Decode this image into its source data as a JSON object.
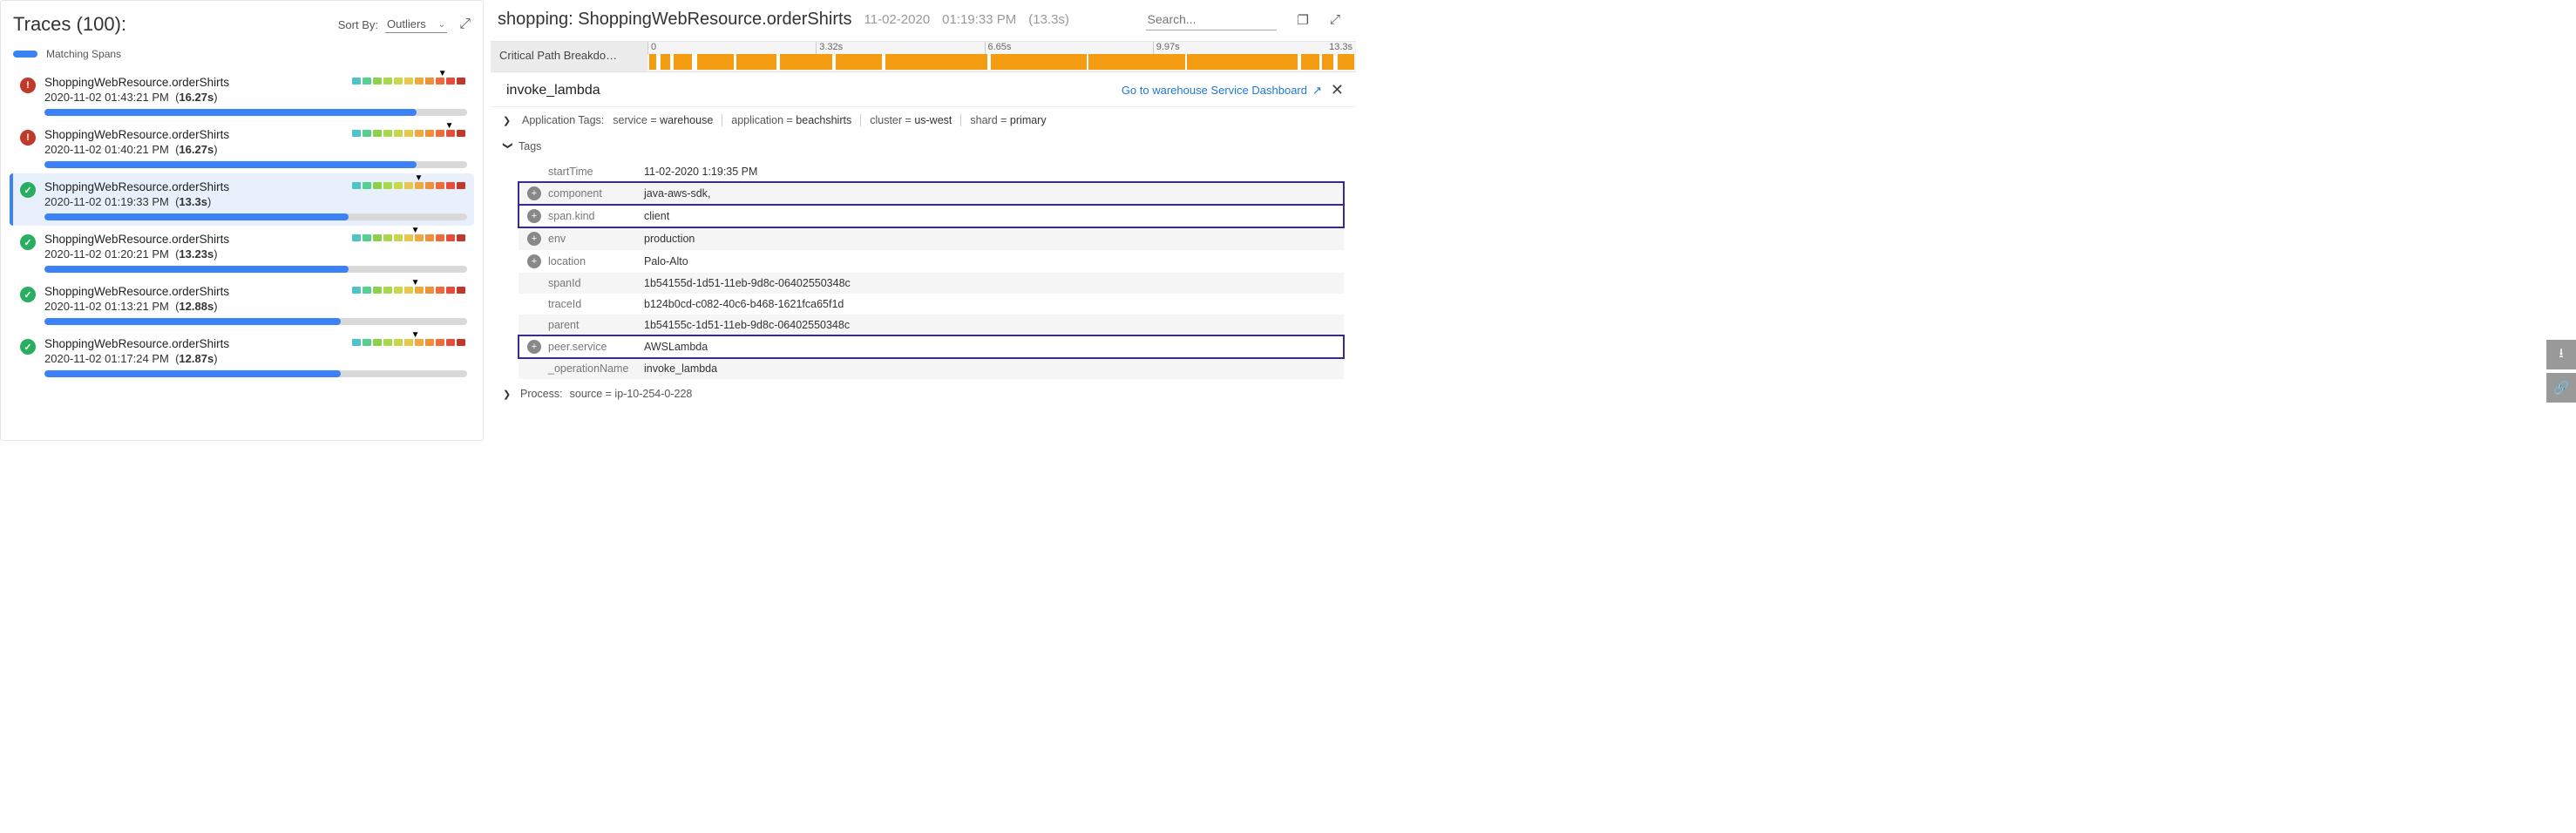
{
  "left": {
    "title": "Traces (100):",
    "sortLabel": "Sort By:",
    "sortValue": "Outliers",
    "legend": "Matching Spans",
    "traces": [
      {
        "status": "error",
        "name": "ShoppingWebResource.orderShirts",
        "ts": "2020-11-02 01:43:21 PM",
        "dur": "16.27s",
        "prog": 88,
        "marker": 76,
        "selected": false
      },
      {
        "status": "error",
        "name": "ShoppingWebResource.orderShirts",
        "ts": "2020-11-02 01:40:21 PM",
        "dur": "16.27s",
        "prog": 88,
        "marker": 82,
        "selected": false
      },
      {
        "status": "ok",
        "name": "ShoppingWebResource.orderShirts",
        "ts": "2020-11-02 01:19:33 PM",
        "dur": "13.3s",
        "prog": 72,
        "marker": 55,
        "selected": true
      },
      {
        "status": "ok",
        "name": "ShoppingWebResource.orderShirts",
        "ts": "2020-11-02 01:20:21 PM",
        "dur": "13.23s",
        "prog": 72,
        "marker": 52,
        "selected": false
      },
      {
        "status": "ok",
        "name": "ShoppingWebResource.orderShirts",
        "ts": "2020-11-02 01:13:21 PM",
        "dur": "12.88s",
        "prog": 70,
        "marker": 52,
        "selected": false
      },
      {
        "status": "ok",
        "name": "ShoppingWebResource.orderShirts",
        "ts": "2020-11-02 01:17:24 PM",
        "dur": "12.87s",
        "prog": 70,
        "marker": 52,
        "selected": false
      }
    ]
  },
  "right": {
    "titlePrefix": "shopping: ",
    "titleMain": "ShoppingWebResource.orderShirts",
    "date": "11-02-2020",
    "time": "01:19:33 PM",
    "dur": "(13.3s)",
    "searchPlaceholder": "Search...",
    "timelineLabel": "Critical Path Breakdo…",
    "ticks": [
      "0",
      "3.32s",
      "6.65s",
      "9.97s",
      "13.3s"
    ],
    "spanName": "invoke_lambda",
    "dashLink": "Go to warehouse Service Dashboard",
    "appTagsLabel": "Application Tags:",
    "appTags": [
      {
        "k": "service",
        "v": "warehouse"
      },
      {
        "k": "application",
        "v": "beachshirts"
      },
      {
        "k": "cluster",
        "v": "us-west"
      },
      {
        "k": "shard",
        "v": "primary"
      }
    ],
    "tagsLabel": "Tags",
    "tags": [
      {
        "add": false,
        "key": "startTime",
        "val": "11-02-2020 1:19:35 PM",
        "alt": false,
        "boxed": false
      },
      {
        "add": true,
        "key": "component",
        "val": "java-aws-sdk,",
        "alt": true,
        "boxed": true
      },
      {
        "add": true,
        "key": "span.kind",
        "val": "client",
        "alt": false,
        "boxed": true
      },
      {
        "add": true,
        "key": "env",
        "val": "production",
        "alt": true,
        "boxed": false
      },
      {
        "add": true,
        "key": "location",
        "val": "Palo-Alto",
        "alt": false,
        "boxed": false
      },
      {
        "add": false,
        "key": "spanId",
        "val": "1b54155d-1d51-11eb-9d8c-06402550348c",
        "alt": true,
        "boxed": false
      },
      {
        "add": false,
        "key": "traceId",
        "val": "b124b0cd-c082-40c6-b468-1621fca65f1d",
        "alt": false,
        "boxed": false
      },
      {
        "add": false,
        "key": "parent",
        "val": "1b54155c-1d51-11eb-9d8c-06402550348c",
        "alt": true,
        "boxed": false
      },
      {
        "add": true,
        "key": "peer.service",
        "val": "AWSLambda",
        "alt": false,
        "boxed": true
      },
      {
        "add": false,
        "key": "_operationName",
        "val": "invoke_lambda",
        "alt": true,
        "boxed": false
      }
    ],
    "processLabel": "Process:",
    "processKey": "source",
    "processVal": "ip-10-254-0-228"
  },
  "heatColors": [
    "#4fc3c7",
    "#55d08e",
    "#8bd24a",
    "#a8d94a",
    "#c9d84a",
    "#e6c84a",
    "#f0a93e",
    "#f38f3a",
    "#ef6c3a",
    "#e74c3c",
    "#c0392b"
  ]
}
